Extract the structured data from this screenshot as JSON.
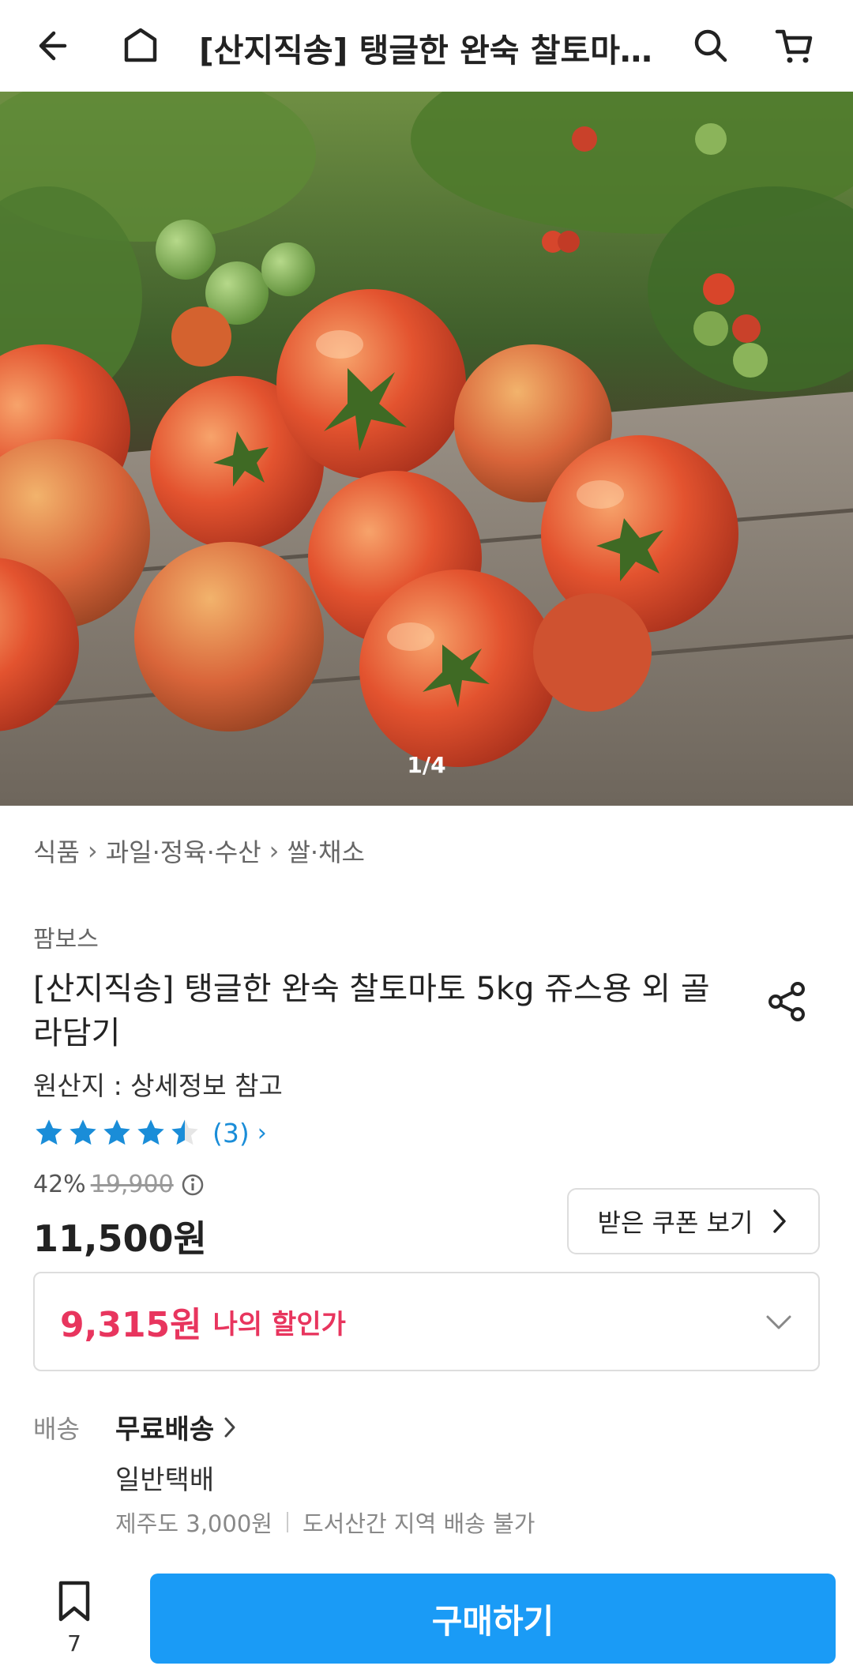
{
  "header": {
    "title": "[산지직송] 탱글한 완숙 찰토마…",
    "icons": [
      "back-arrow-icon",
      "home-icon",
      "search-icon",
      "cart-icon"
    ]
  },
  "hero": {
    "pager": "1/4"
  },
  "breadcrumb": {
    "items": [
      "식품",
      "과일·정육·수산",
      "쌀·채소"
    ]
  },
  "product": {
    "seller": "팜보스",
    "title": "[산지직송] 탱글한 완숙 찰토마토 5kg 쥬스용 외 골라담기",
    "origin": "원산지 : 상세정보 참고",
    "rating_stars": 4.5,
    "rating_count": "(3)",
    "discount_rate": "42%",
    "original_price": "19,900",
    "price": "11,500원",
    "coupon_label": "받은 쿠폰 보기",
    "my_discount_price": "9,315원",
    "my_discount_label": "나의 할인가"
  },
  "shipping": {
    "label": "배송",
    "type": "무료배송",
    "method": "일반택배",
    "jeju_fee": "제주도 3,000원",
    "restriction": "도서산간 지역 배송 불가"
  },
  "bottom": {
    "wish_count": "7",
    "buy_label": "구매하기"
  },
  "colors": {
    "accent": "#1a9bf6",
    "discount": "#e8355e",
    "rating": "#1a8dd8"
  }
}
